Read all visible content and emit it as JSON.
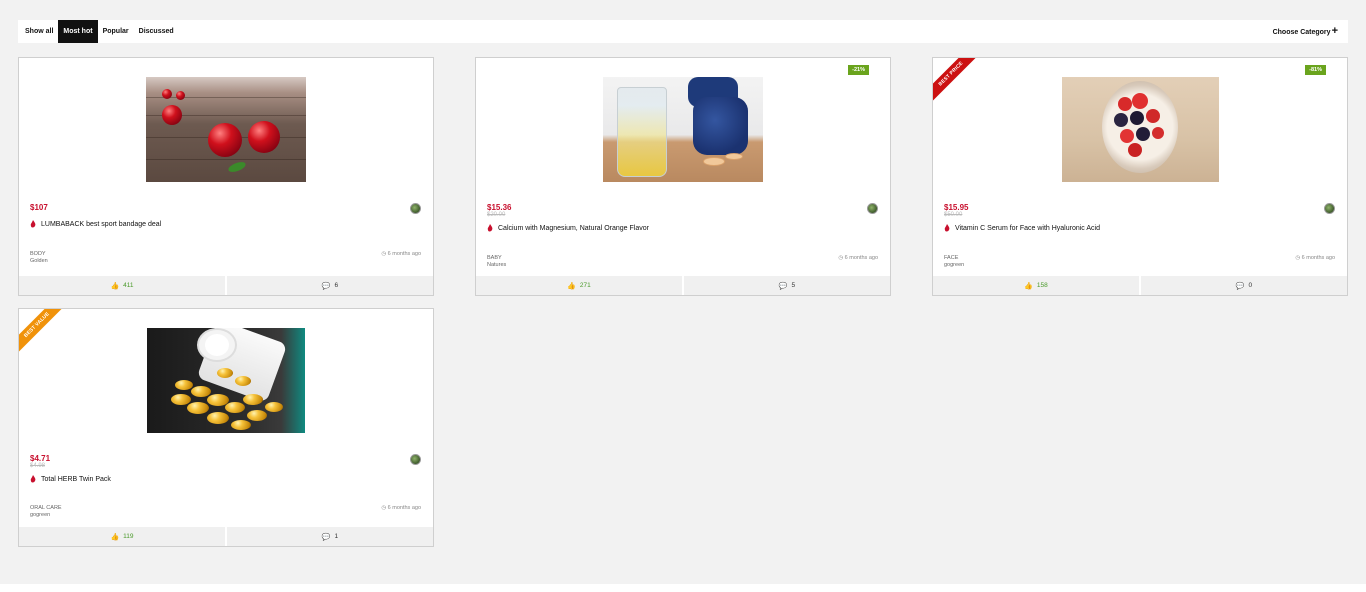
{
  "filters": {
    "tabs": [
      {
        "label": "Show all"
      },
      {
        "label": "Most hot",
        "active": true
      },
      {
        "label": "Popular"
      },
      {
        "label": "Discussed"
      }
    ],
    "choose_category": "Choose Category",
    "choose_category_icon": "+"
  },
  "colors": {
    "price": "#c8102e",
    "discount_badge": "#6aa41d",
    "ribbon_best_price": "#cc1111",
    "ribbon_best_value": "#f0920a",
    "likes": "#4a9a2a"
  },
  "deals": [
    {
      "image": "cherries",
      "price": "$107",
      "old_price": "",
      "title": "LUMBABACK best sport bandage deal",
      "category": "BODY",
      "author": "Golden",
      "time": "6 months ago",
      "likes": "411",
      "comments": "6",
      "discount": "",
      "ribbon": ""
    },
    {
      "image": "water-glass-dumbbells",
      "price": "$15.36",
      "old_price": "$20.00",
      "title": "Calcium with Magnesium, Natural Orange Flavor",
      "category": "BABY",
      "author": "Natures",
      "time": "6 months ago",
      "likes": "271",
      "comments": "5",
      "discount": "-21%",
      "ribbon": ""
    },
    {
      "image": "berries-bowl",
      "price": "$15.95",
      "old_price": "$50.00",
      "title": "Vitamin C Serum for Face with Hyaluronic Acid",
      "category": "FACE",
      "author": "gogreen",
      "time": "6 months ago",
      "likes": "158",
      "comments": "0",
      "discount": "-81%",
      "ribbon": "BEST PRICE"
    },
    {
      "image": "oil-capsules",
      "price": "$4.71",
      "old_price": "$4.98",
      "title": "Total HERB Twin Pack",
      "category": "ORAL CARE",
      "author": "gogreen",
      "time": "6 months ago",
      "likes": "119",
      "comments": "1",
      "discount": "",
      "ribbon": "BEST VALUE"
    }
  ],
  "icons": {
    "time": "clock-icon",
    "likes": "thumbs-up-icon",
    "comments": "comment-icon",
    "hot": "flame-icon"
  }
}
